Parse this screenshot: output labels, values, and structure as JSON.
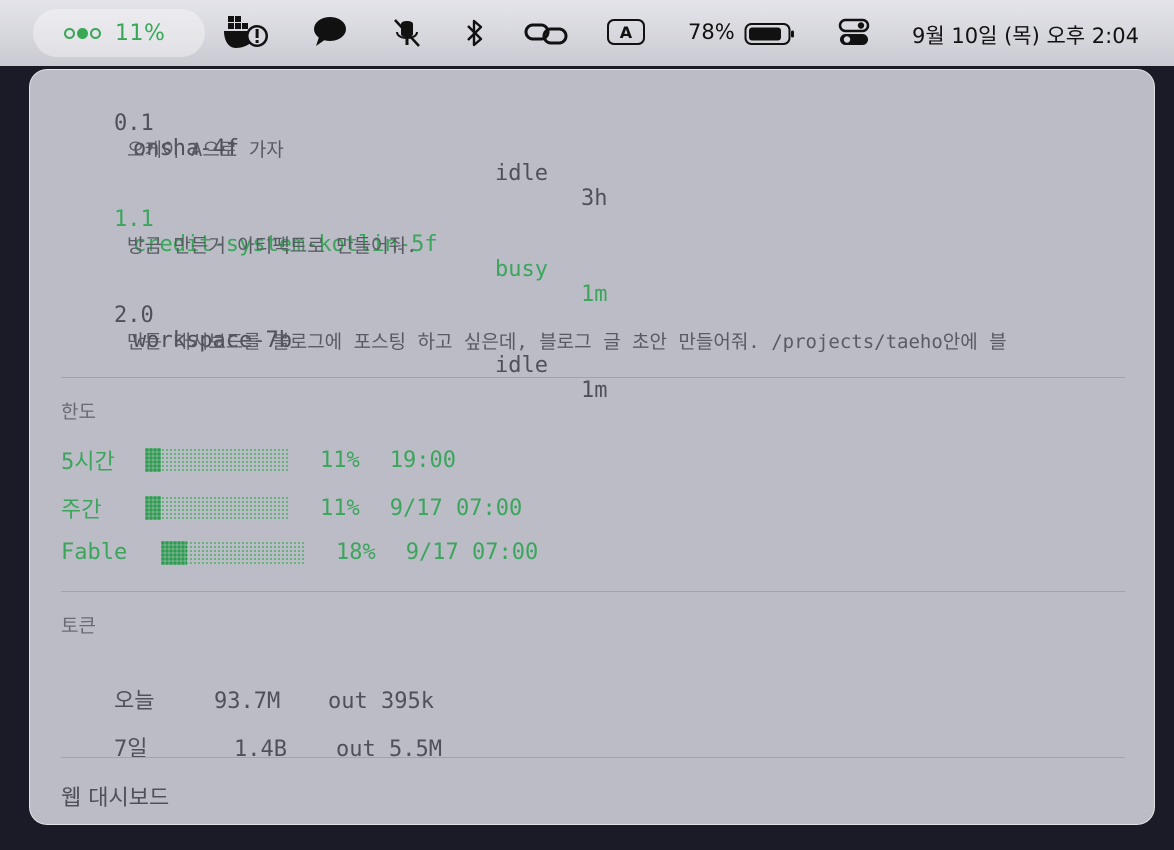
{
  "menubar": {
    "status_percent": "11%",
    "battery_percent": "78%",
    "input_source": "A",
    "datetime": "9월 10일 (목) 오후 2:04",
    "icons": [
      "docker-icon",
      "chat-bubble-icon",
      "mute-icon",
      "bluetooth-icon",
      "link-icon",
      "input-source-icon",
      "battery-icon",
      "control-center-icon"
    ]
  },
  "sessions": [
    {
      "id": "0.1",
      "name": "onsha-4f",
      "state": "idle",
      "age": "3h",
      "message": "오케이 A으로 가자",
      "status": "idle"
    },
    {
      "id": "1.1",
      "name": "credit-system-kotlin-5f",
      "state": "busy",
      "age": "1m",
      "message": "방금 만든거 아티팩트로 만들어줘.",
      "status": "busy"
    },
    {
      "id": "2.0",
      "name": "workspace-7b",
      "state": "idle",
      "age": "1m",
      "message": "만든 대시보드를 블로그에 포스팅 하고 싶은데, 블로그 글 초안 만들어줘. /projects/taeho안에 블",
      "status": "idle"
    }
  ],
  "limits": {
    "title": "한도",
    "rows": [
      {
        "label": "5시간",
        "percent_text": "11%",
        "percent": 11,
        "reset": "19:00"
      },
      {
        "label": "주간",
        "percent_text": "11%",
        "percent": 11,
        "reset": "9/17 07:00"
      },
      {
        "label": "Fable",
        "percent_text": "18%",
        "percent": 18,
        "reset": "9/17 07:00"
      }
    ]
  },
  "tokens": {
    "title": "토큰",
    "rows": [
      {
        "label": "오늘",
        "total": "93.7M",
        "out": "out 395k"
      },
      {
        "label": "7일",
        "total": "1.4B",
        "out": "out 5.5M"
      }
    ]
  },
  "footer": {
    "dashboard_link": "웹 대시보드"
  },
  "colors": {
    "accent_green": "#3aa55b",
    "panel_bg": "#bcbcc7",
    "text": "#50505a"
  }
}
